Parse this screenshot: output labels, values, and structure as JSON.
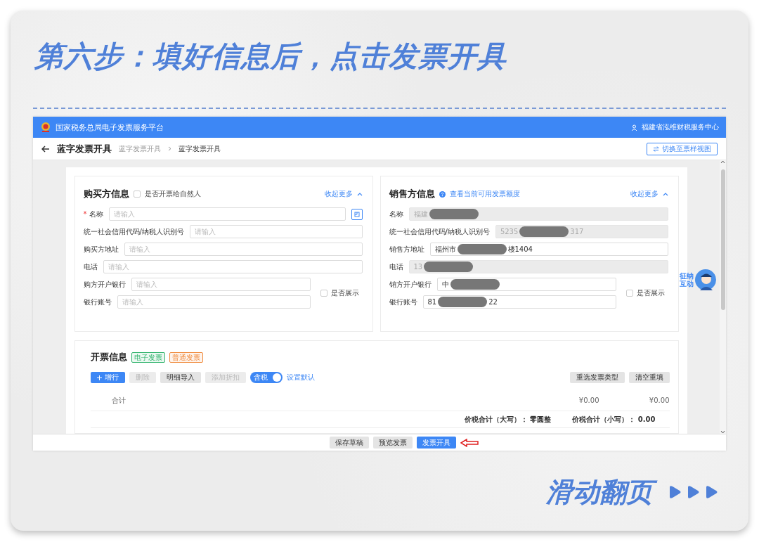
{
  "slide_title": "第六步：填好信息后，点击发票开具",
  "header": {
    "platform": "国家税务总局电子发票服务平台",
    "user": "福建省泓维财税服务中心"
  },
  "page": {
    "title": "蓝字发票开具",
    "breadcrumb": [
      "蓝字发票开具",
      "蓝字发票开具"
    ],
    "view_switch": "切换至票样视图"
  },
  "buyer": {
    "title": "购买方信息",
    "required_mark": "*",
    "natural_person": {
      "label": "是否开票给自然人",
      "checked": false
    },
    "collapse": "收起更多",
    "fields": [
      {
        "label": "名称",
        "required": true,
        "placeholder": "请输入",
        "kind": "lookup"
      },
      {
        "label": "统一社会信用代码/纳税人识别号",
        "required": false,
        "placeholder": "请输入",
        "kind": "text"
      },
      {
        "label": "购买方地址",
        "required": false,
        "placeholder": "请输入",
        "kind": "text"
      },
      {
        "label": "电话",
        "required": false,
        "placeholder": "请输入",
        "kind": "text"
      },
      {
        "label": "购方开户银行",
        "required": false,
        "placeholder": "请输入",
        "kind": "bank"
      },
      {
        "label": "银行账号",
        "required": false,
        "placeholder": "请输入",
        "kind": "bank"
      }
    ],
    "show_option": {
      "label": "是否展示",
      "checked": false
    }
  },
  "seller": {
    "title": "销售方信息",
    "quota_link": "查看当前可用发票额度",
    "collapse": "收起更多",
    "fields": [
      {
        "label": "名称",
        "disabled": true,
        "kind": "text",
        "value_parts": [
          "福建"
        ]
      },
      {
        "label": "统一社会信用代码/纳税人识别号",
        "disabled": true,
        "kind": "text",
        "value_parts": [
          "5235",
          "317"
        ]
      },
      {
        "label": "销售方地址",
        "disabled": false,
        "kind": "text",
        "value_parts": [
          "福州市",
          "楼1404"
        ]
      },
      {
        "label": "电话",
        "disabled": true,
        "kind": "text",
        "value_parts": [
          "13"
        ]
      },
      {
        "label": "销方开户银行",
        "disabled": false,
        "kind": "bank",
        "value_parts": [
          "中"
        ]
      },
      {
        "label": "银行账号",
        "disabled": false,
        "kind": "bank",
        "value_parts": [
          "81",
          "22"
        ]
      }
    ],
    "show_option": {
      "label": "是否展示",
      "checked": false
    }
  },
  "invoice": {
    "title": "开票信息",
    "tags": [
      {
        "label": "电子发票",
        "color": "#2fb36b"
      },
      {
        "label": "普通发票",
        "color": "#f08a3c"
      }
    ],
    "buttons": [
      {
        "label": "增行",
        "kind": "primary",
        "disabled": false
      },
      {
        "label": "删除",
        "kind": "plain",
        "disabled": true
      },
      {
        "label": "明细导入",
        "kind": "plain",
        "disabled": false
      },
      {
        "label": "添加折扣",
        "kind": "plain",
        "disabled": true
      }
    ],
    "tax_toggle": {
      "label": "含税",
      "on": true
    },
    "default_link": "设置默认",
    "right_buttons": [
      "重选发票类型",
      "清空重填"
    ],
    "total_row": {
      "label": "合计",
      "amount": "¥0.00",
      "tax": "¥0.00"
    },
    "summary": [
      {
        "label": "价税合计（大写）：",
        "value": "零圆整"
      },
      {
        "label": "价税合计（小写）：",
        "value": "0.00"
      }
    ]
  },
  "footer_buttons": [
    {
      "label": "保存草稿",
      "primary": false,
      "highlighted": false
    },
    {
      "label": "预览发票",
      "primary": false,
      "highlighted": false
    },
    {
      "label": "发票开具",
      "primary": true,
      "highlighted": true
    }
  ],
  "assistant": {
    "label": "征纳互动"
  },
  "pager": {
    "label": "滑动翻页"
  }
}
